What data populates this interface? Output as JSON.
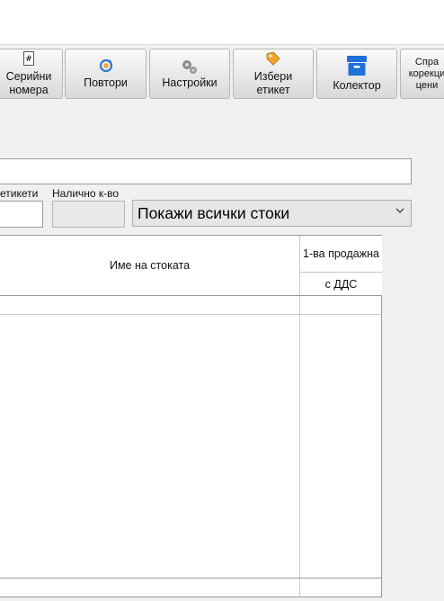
{
  "toolbar": {
    "serial_numbers": [
      "Серийни",
      "номера"
    ],
    "repeats": "Повтори",
    "settings": "Настройки",
    "choose_label": [
      "Избери",
      "етикет"
    ],
    "collector": "Колектор",
    "reference": [
      "Спра",
      "корекци",
      "цени"
    ]
  },
  "form": {
    "labels_caption": "етикети",
    "available_qty_caption": "Налично к-во",
    "show_filter_value": "Покажи всички стоки"
  },
  "grid": {
    "col_name": "Име на стоката",
    "col_first_sale": "1-ва продажна",
    "col_vat": "с ДДС"
  },
  "colors": {
    "accent": "#1e6fd9",
    "window_bg": "#f0f0f0"
  }
}
